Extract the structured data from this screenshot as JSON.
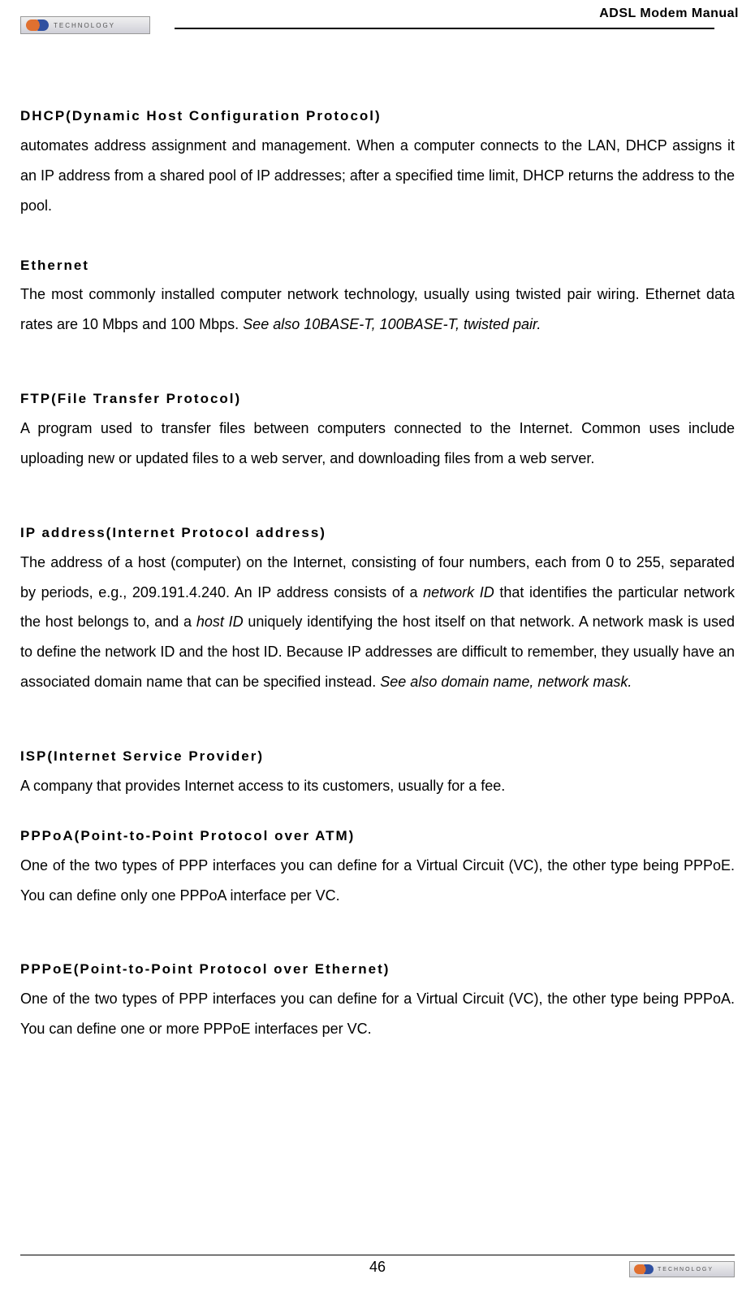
{
  "header": {
    "title": "ADSL Modem Manual",
    "logo_text": "TECHNOLOGY"
  },
  "entries": {
    "dhcp": {
      "term": "DHCP(Dynamic Host Configuration Protocol)",
      "def": "automates address assignment and management. When a computer connects to the LAN, DHCP assigns it an IP address from a shared pool of IP addresses; after a specified time limit, DHCP returns the address to the pool."
    },
    "ethernet": {
      "term": "Ethernet",
      "def_a": "The most commonly installed computer network technology, usually using twisted pair wiring. Ethernet data rates are 10 Mbps and 100 Mbps. ",
      "see": "See also 10BASE-T, 100BASE-T, twisted pair."
    },
    "ftp": {
      "term": "FTP(File Transfer Protocol)",
      "def": "A program used to transfer files between computers connected to the Internet. Common uses include uploading new or updated files to a web server, and downloading files from a web server."
    },
    "ip": {
      "term": "IP address(Internet Protocol address)",
      "d1": "The address of a host (computer) on the Internet, consisting of four numbers, each from 0 to 255, separated by periods, e.g., 209.191.4.240. An IP address consists of a ",
      "em1": "network ID",
      "d2": " that identifies the particular network the host belongs to, and a ",
      "em2": "host ID",
      "d3": " uniquely identifying the host itself on that network. A network mask is used to define the network ID and the host ID. Because IP addresses are difficult to remember, they usually have an associated domain name that can be specified instead. ",
      "see": "See also domain name, network mask."
    },
    "isp": {
      "term": "ISP(Internet Service Provider)",
      "def": "A company that provides Internet access to its customers, usually for a fee."
    },
    "pppoa": {
      "term": "PPPoA(Point-to-Point Protocol over ATM)",
      "def": "One of the two types of PPP interfaces you can define for a Virtual Circuit (VC), the other type being PPPoE. You can define only one PPPoA interface per VC."
    },
    "pppoe": {
      "term": "PPPoE(Point-to-Point Protocol over Ethernet)",
      "def": "One of the two types of PPP interfaces you can define for a Virtual Circuit (VC), the other type being PPPoA. You can define one or more PPPoE interfaces per VC."
    }
  },
  "footer": {
    "page_number": "46",
    "logo_text": "TECHNOLOGY"
  }
}
